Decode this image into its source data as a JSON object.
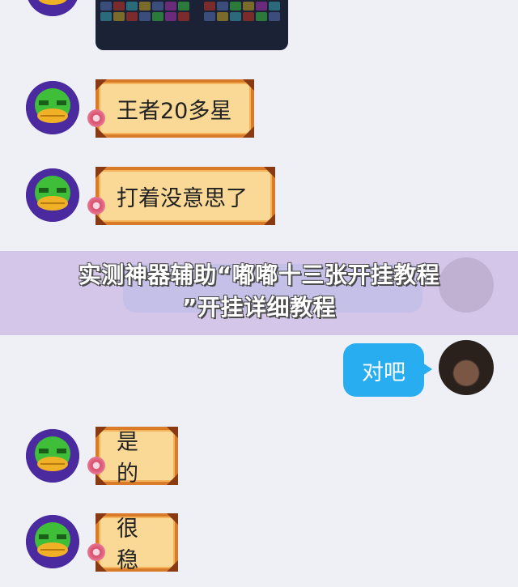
{
  "messages": [
    {
      "side": "left",
      "avatar": "duck-avatar",
      "text": "王者20多星"
    },
    {
      "side": "left",
      "avatar": "duck-avatar",
      "text": "打着没意思了"
    },
    {
      "side": "right",
      "avatar": "photo-avatar",
      "text": "对吧"
    },
    {
      "side": "left",
      "avatar": "duck-avatar",
      "text": "是的"
    },
    {
      "side": "left",
      "avatar": "duck-avatar",
      "text": "很稳"
    }
  ],
  "overlay_title": {
    "line1": "实测神器辅助“嘟嘟十三张开挂教程",
    "line2": "”开挂详细教程"
  },
  "colors": {
    "bubble_orange": "#f9d995",
    "bubble_border": "#d97b28",
    "bubble_blue": "#28aef0",
    "avatar_bg": "#4b2aa0",
    "banner": "#cebce4"
  }
}
